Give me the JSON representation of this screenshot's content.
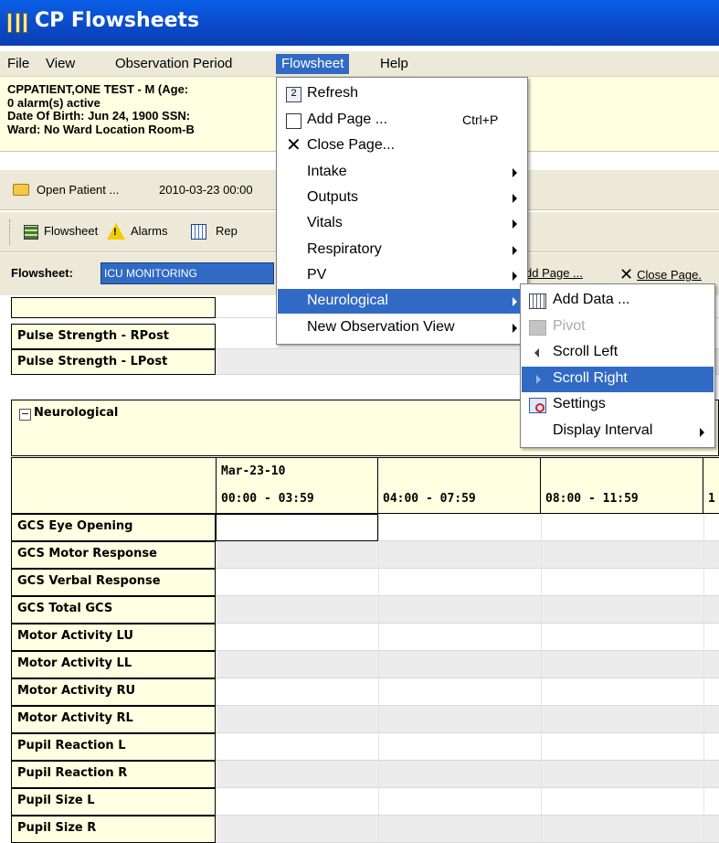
{
  "window": {
    "title": "CP Flowsheets"
  },
  "menubar": {
    "items": [
      "File",
      "View",
      "Observation Period",
      "Flowsheet",
      "Help"
    ]
  },
  "patient": {
    "line1": "CPPATIENT,ONE TEST - M (Age:",
    "line2": "0 alarm(s) active",
    "line3": "Date Of Birth: Jun 24, 1900  SSN:",
    "line4": "Ward: No Ward Location  Room-B"
  },
  "toolbar1": {
    "open_patient": "Open Patient ...",
    "period": "2010-03-23 00:00"
  },
  "toolbar2": {
    "flowsheet": "Flowsheet",
    "alarms": "Alarms",
    "reports": "Rep"
  },
  "flowsheet_row": {
    "label": "Flowsheet:",
    "value": "ICU MONITORING",
    "add_page": "dd Page ...",
    "close_page": "Close Page."
  },
  "upper_rows": [
    "Pulse Strength - RPost",
    "Pulse Strength - LPost"
  ],
  "neuro": {
    "section_label": "Neurological",
    "expander": "⊟",
    "date": "Mar-23-10",
    "columns": [
      "00:00 - 03:59",
      "04:00 - 07:59",
      "08:00 - 11:59",
      "1"
    ],
    "rows": [
      "GCS Eye Opening",
      "GCS Motor Response",
      "GCS Verbal Response",
      "GCS Total GCS",
      "Motor Activity LU",
      "Motor Activity LL",
      "Motor Activity RU",
      "Motor Activity RL",
      "Pupil Reaction L",
      "Pupil Reaction R",
      "Pupil Size L",
      "Pupil Size R"
    ]
  },
  "flowsheet_menu": {
    "items": [
      {
        "label": "Refresh",
        "icon": "refresh-icon"
      },
      {
        "label": "Add Page ...",
        "shortcut": "Ctrl+P",
        "icon": "page-icon"
      },
      {
        "label": "Close Page...",
        "icon": "close-icon"
      },
      {
        "label": "Intake",
        "submenu": true
      },
      {
        "label": "Outputs",
        "submenu": true
      },
      {
        "label": "Vitals",
        "submenu": true
      },
      {
        "label": "Respiratory",
        "submenu": true
      },
      {
        "label": "PV",
        "submenu": true
      },
      {
        "label": "Neurological",
        "submenu": true,
        "highlighted": true
      },
      {
        "label": "New Observation View",
        "submenu": true
      }
    ]
  },
  "neuro_submenu": {
    "items": [
      {
        "label": "Add Data ...",
        "icon": "add-data-icon"
      },
      {
        "label": "Pivot",
        "icon": "pivot-icon",
        "disabled": true
      },
      {
        "label": "Scroll Left",
        "icon": "arrow-left-icon"
      },
      {
        "label": "Scroll Right",
        "icon": "arrow-right-icon",
        "highlighted": true
      },
      {
        "label": "Settings",
        "icon": "settings-icon"
      },
      {
        "label": "Display Interval",
        "submenu": true
      }
    ]
  },
  "colors": {
    "menu_highlight": "#316ac5",
    "label_bg": "#ffffe1",
    "title_bar": "#0b49c8"
  }
}
